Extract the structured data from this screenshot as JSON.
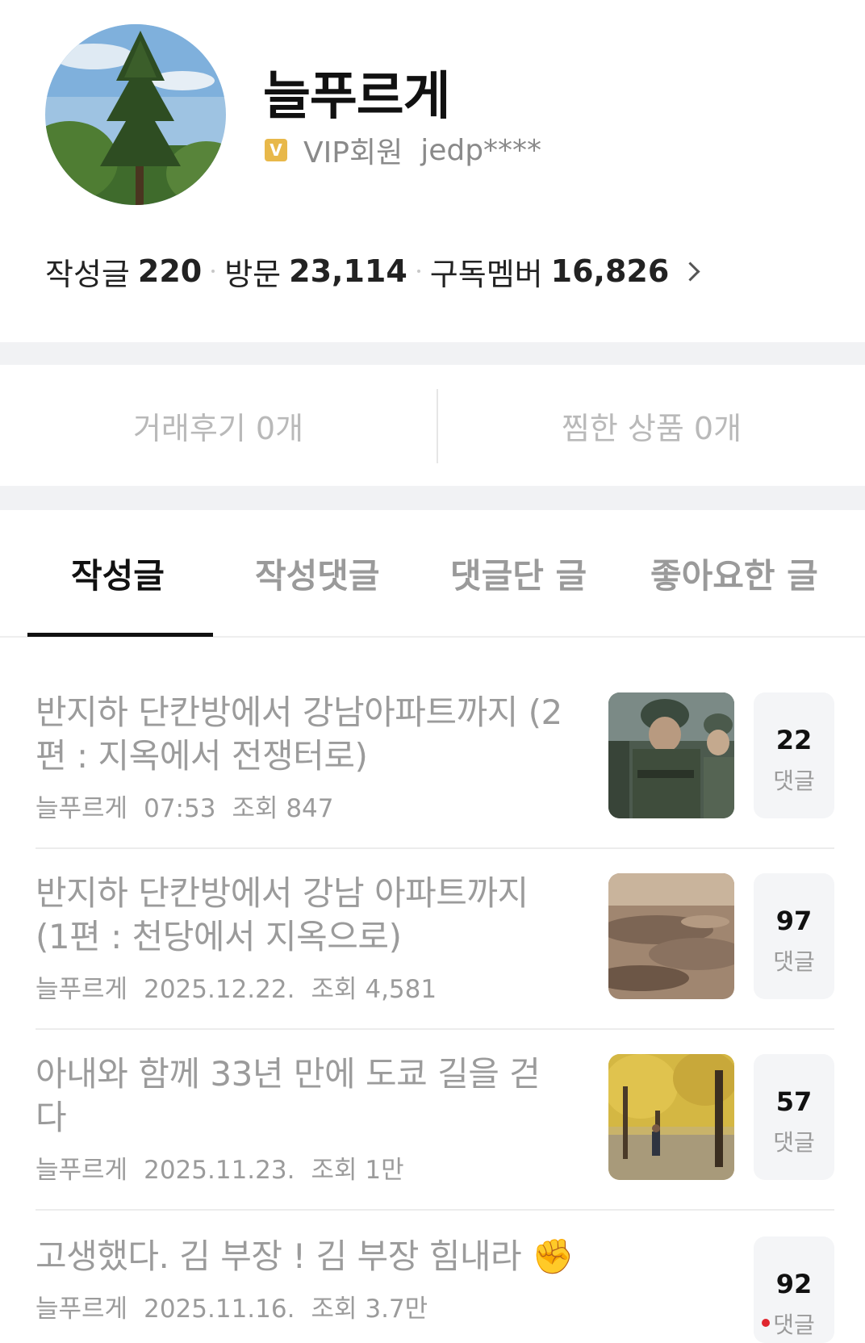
{
  "profile": {
    "nickname": "늘푸르게",
    "grade_badge": "V",
    "grade": "VIP회원",
    "user_id": "jedp****",
    "stats": [
      {
        "label": "작성글",
        "value": "220"
      },
      {
        "label": "방문",
        "value": "23,114"
      },
      {
        "label": "구독멤버",
        "value": "16,826"
      }
    ]
  },
  "trade": {
    "reviews": "거래후기 0개",
    "wishlist": "찜한 상품 0개"
  },
  "tabs": [
    "작성글",
    "작성댓글",
    "댓글단 글",
    "좋아요한 글"
  ],
  "active_tab": "작성글",
  "posts": [
    {
      "title": "반지하 단칸방에서 강남아파트까지 (2편 : 지옥에서 전쟁터로)",
      "author": "늘푸르게",
      "date": "07:53",
      "views": "조회 847",
      "comments": "22",
      "comment_label": "댓글",
      "thumbnail": "soldiers-photo"
    },
    {
      "title": "반지하 단칸방에서 강남 아파트까지 (1편 : 천당에서 지옥으로)",
      "author": "늘푸르게",
      "date": "2025.12.22.",
      "views": "조회 4,581",
      "comments": "97",
      "comment_label": "댓글",
      "thumbnail": "aerial-landscape-photo"
    },
    {
      "title": "아내와 함께 33년 만에 도쿄 길을 걷다",
      "author": "늘푸르게",
      "date": "2025.11.23.",
      "views": "조회 1만",
      "comments": "57",
      "comment_label": "댓글",
      "thumbnail": "ginkgo-avenue-photo"
    },
    {
      "title": "고생했다. 김 부장 ! 김 부장 힘내라 ✊",
      "author": "늘푸르게",
      "date": "2025.11.16.",
      "views": "조회 3.7만",
      "comments": "92",
      "comment_label": "댓글",
      "new_comment": true
    }
  ],
  "colors": {
    "badge": "#e8b84a",
    "new_dot": "#e0262e",
    "separator": "#f1f2f4"
  }
}
